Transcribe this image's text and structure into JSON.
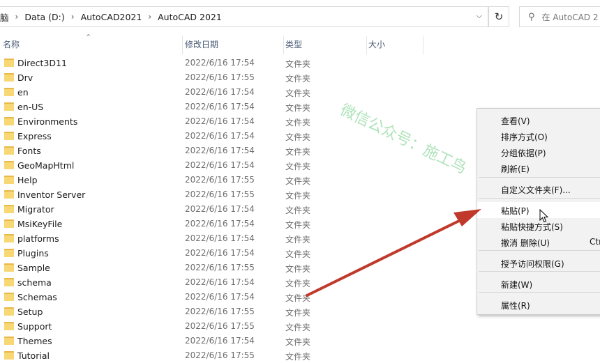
{
  "address_bar": {
    "crumbs": [
      "脑",
      "Data (D:)",
      "AutoCAD2021",
      "AutoCAD 2021"
    ],
    "refresh_icon": "refresh-icon",
    "dropdown_icon": "chevron-down-icon"
  },
  "search": {
    "placeholder": "在 AutoCAD 2"
  },
  "columns": {
    "name": "名称",
    "date": "修改日期",
    "type": "类型",
    "size": "大小"
  },
  "files": [
    {
      "name": "Direct3D11",
      "date": "2022/6/16 17:54",
      "type": "文件夹"
    },
    {
      "name": "Drv",
      "date": "2022/6/16 17:55",
      "type": "文件夹"
    },
    {
      "name": "en",
      "date": "2022/6/16 17:54",
      "type": "文件夹"
    },
    {
      "name": "en-US",
      "date": "2022/6/16 17:54",
      "type": "文件夹"
    },
    {
      "name": "Environments",
      "date": "2022/6/16 17:54",
      "type": "文件夹"
    },
    {
      "name": "Express",
      "date": "2022/6/16 17:54",
      "type": "文件夹"
    },
    {
      "name": "Fonts",
      "date": "2022/6/16 17:54",
      "type": "文件夹"
    },
    {
      "name": "GeoMapHtml",
      "date": "2022/6/16 17:54",
      "type": "文件夹"
    },
    {
      "name": "Help",
      "date": "2022/6/16 17:55",
      "type": "文件夹"
    },
    {
      "name": "Inventor Server",
      "date": "2022/6/16 17:55",
      "type": "文件夹"
    },
    {
      "name": "Migrator",
      "date": "2022/6/16 17:54",
      "type": "文件夹"
    },
    {
      "name": "MsiKeyFile",
      "date": "2022/6/16 17:54",
      "type": "文件夹"
    },
    {
      "name": "platforms",
      "date": "2022/6/16 17:54",
      "type": "文件夹"
    },
    {
      "name": "Plugins",
      "date": "2022/6/16 17:54",
      "type": "文件夹"
    },
    {
      "name": "Sample",
      "date": "2022/6/16 17:55",
      "type": "文件夹"
    },
    {
      "name": "schema",
      "date": "2022/6/16 17:54",
      "type": "文件夹"
    },
    {
      "name": "Schemas",
      "date": "2022/6/16 17:54",
      "type": "文件夹"
    },
    {
      "name": "Setup",
      "date": "2022/6/16 17:55",
      "type": "文件夹"
    },
    {
      "name": "Support",
      "date": "2022/6/16 17:55",
      "type": "文件夹"
    },
    {
      "name": "Themes",
      "date": "2022/6/16 17:54",
      "type": "文件夹"
    },
    {
      "name": "Tutorial",
      "date": "2022/6/16 17:55",
      "type": "文件夹"
    }
  ],
  "context_menu": {
    "items": [
      {
        "label": "查看(V)"
      },
      {
        "label": "排序方式(O)"
      },
      {
        "label": "分组依据(P)"
      },
      {
        "label": "刷新(E)"
      },
      {
        "label": "自定义文件夹(F)..."
      },
      {
        "label": "粘贴(P)",
        "highlighted": true
      },
      {
        "label": "粘贴快捷方式(S)"
      },
      {
        "label": "撤消 删除(U)",
        "shortcut": "Ctr"
      },
      {
        "label": "授予访问权限(G)"
      },
      {
        "label": "新建(W)"
      },
      {
        "label": "属性(R)"
      }
    ]
  },
  "watermark": {
    "text": "微信公众号：施工鸟"
  },
  "colors": {
    "arrow": "#c0392b",
    "folder": "#f8d775",
    "header_text": "#4a5a75",
    "menu_bg": "#f2f2f2",
    "watermark": "#2db84a"
  }
}
